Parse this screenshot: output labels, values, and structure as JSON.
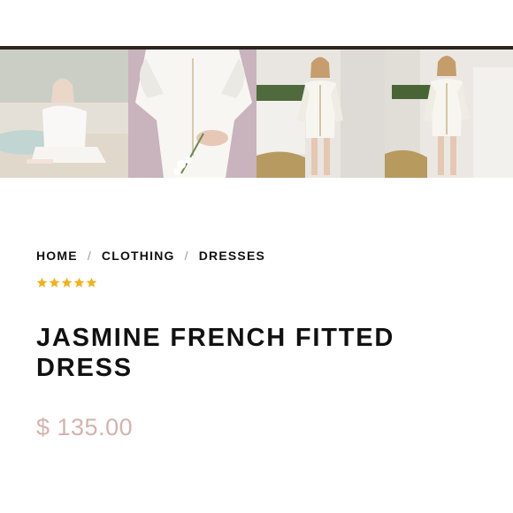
{
  "breadcrumb": {
    "items": [
      "HOME",
      "CLOTHING",
      "DRESSES"
    ],
    "separator": "/"
  },
  "rating": {
    "value": 5,
    "max": 5,
    "color": "#f2b21b"
  },
  "product": {
    "title": "JASMINE FRENCH FITTED DRESS",
    "price": "$ 135.00",
    "price_color": "#d5b2ad"
  },
  "gallery": {
    "selected_index": 1
  },
  "colors": {
    "top_strip": "#2b2420",
    "text": "#111111"
  }
}
